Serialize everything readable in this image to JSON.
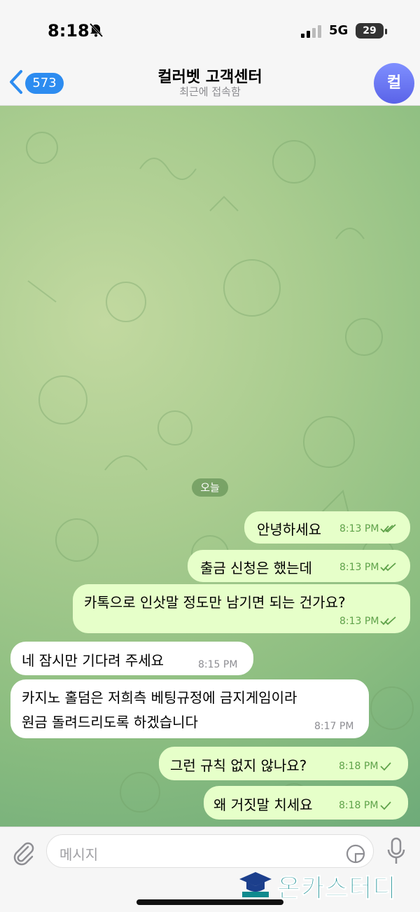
{
  "status_bar": {
    "time": "8:18",
    "network": "5G",
    "battery": "29"
  },
  "header": {
    "back_count": "573",
    "title": "컬러벳 고객센터",
    "subtitle": "최근에 접속함",
    "avatar_letter": "컬"
  },
  "date_chip": "오늘",
  "messages": [
    {
      "direction": "out",
      "text": "안녕하세요",
      "time": "8:13 PM",
      "read": true
    },
    {
      "direction": "out",
      "text": "출금 신청은 했는데",
      "time": "8:13 PM",
      "read": true
    },
    {
      "direction": "out",
      "text": "카톡으로 인삿말 정도만 남기면 되는 건가요?",
      "time": "8:13 PM",
      "read": true
    },
    {
      "direction": "in",
      "text": "네 잠시만 기다려 주세요",
      "time": "8:15 PM"
    },
    {
      "direction": "in",
      "text_lines": [
        "카지노 홀덤은 저희측 베팅규정에 금지게임이라",
        "원금 돌려드리도록 하겠습니다"
      ],
      "time": "8:17 PM"
    },
    {
      "direction": "out",
      "text": "그런 규칙 없지 않나요?",
      "time": "8:18 PM",
      "read": false
    },
    {
      "direction": "out",
      "text": "왜 거짓말 치세요",
      "time": "8:18 PM",
      "read": false
    }
  ],
  "composer": {
    "placeholder": "메시지"
  },
  "watermark": "온카스터디",
  "colors": {
    "accent": "#2d8cf0",
    "outgoing_bubble": "#e6ffc9",
    "incoming_bubble": "#ffffff",
    "check": "#5fa24a"
  },
  "icons": [
    "bell-slash-icon",
    "signal-icon",
    "battery-icon",
    "chevron-left-icon",
    "double-check-icon",
    "single-check-icon",
    "paperclip-icon",
    "sticker-icon",
    "microphone-icon",
    "graduation-cap-icon"
  ]
}
